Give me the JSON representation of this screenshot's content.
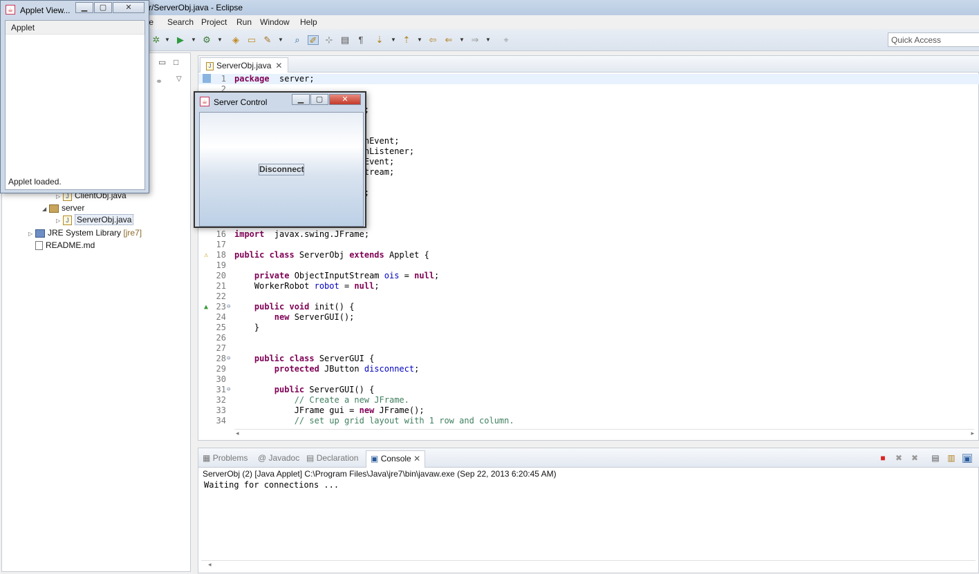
{
  "window": {
    "title": "r/ServerObj.java - Eclipse"
  },
  "menu": [
    "te",
    "Search",
    "Project",
    "Run",
    "Window",
    "Help"
  ],
  "quick_access": {
    "placeholder": "Quick Access"
  },
  "explorer": {
    "items": [
      {
        "label": "ClientObj.java"
      },
      {
        "label": "server"
      },
      {
        "label": "ServerObj.java"
      },
      {
        "label": "JRE System Library",
        "suffix": "[jre7]"
      },
      {
        "label": "README.md"
      }
    ]
  },
  "editor": {
    "tab_label": "ServerObj.java",
    "lines": [
      {
        "n": "1",
        "parts": [
          [
            "kw",
            "package"
          ],
          [
            "",
            "  server;"
          ]
        ]
      },
      {
        "n": "2",
        "parts": []
      },
      {
        "n": "",
        "parts": [
          [
            "",
            ";"
          ]
        ],
        "indent": "                          "
      },
      {
        "n": "",
        "parts": [
          [
            "",
            "nEvent;"
          ]
        ],
        "indent": "                          "
      },
      {
        "n": "",
        "parts": [
          [
            "",
            "nListener;"
          ]
        ],
        "indent": "                          "
      },
      {
        "n": "",
        "parts": [
          [
            "",
            "Event;"
          ]
        ],
        "indent": "                          "
      },
      {
        "n": "",
        "parts": [
          [
            "",
            "tream;"
          ]
        ],
        "indent": "                          "
      },
      {
        "n": "",
        "parts": [
          [
            "",
            ";"
          ]
        ],
        "indent": "                          "
      },
      {
        "n": "16",
        "parts": [
          [
            "kw",
            "import"
          ],
          [
            "",
            "  javax.swing.JFrame;"
          ]
        ]
      },
      {
        "n": "17",
        "parts": []
      },
      {
        "n": "18",
        "parts": [
          [
            "kw",
            "public class"
          ],
          [
            "",
            " ServerObj "
          ],
          [
            "kw",
            "extends"
          ],
          [
            "",
            " Applet {"
          ]
        ]
      },
      {
        "n": "19",
        "parts": []
      },
      {
        "n": "20",
        "parts": [
          [
            "",
            "    "
          ],
          [
            "kw",
            "private"
          ],
          [
            "",
            " ObjectInputStream "
          ],
          [
            "fld",
            "ois"
          ],
          [
            "",
            " = "
          ],
          [
            "kw",
            "null"
          ],
          [
            "",
            ";"
          ]
        ]
      },
      {
        "n": "21",
        "parts": [
          [
            "",
            "    WorkerRobot "
          ],
          [
            "fld",
            "robot"
          ],
          [
            "",
            " = "
          ],
          [
            "kw",
            "null"
          ],
          [
            "",
            ";"
          ]
        ]
      },
      {
        "n": "22",
        "parts": []
      },
      {
        "n": "23",
        "parts": [
          [
            "",
            "    "
          ],
          [
            "kw",
            "public void"
          ],
          [
            "",
            " init() {"
          ]
        ]
      },
      {
        "n": "24",
        "parts": [
          [
            "",
            "        "
          ],
          [
            "kw",
            "new"
          ],
          [
            "",
            " ServerGUI();"
          ]
        ]
      },
      {
        "n": "25",
        "parts": [
          [
            "",
            "    }"
          ]
        ]
      },
      {
        "n": "26",
        "parts": []
      },
      {
        "n": "27",
        "parts": []
      },
      {
        "n": "28",
        "parts": [
          [
            "",
            "    "
          ],
          [
            "kw",
            "public class"
          ],
          [
            "",
            " ServerGUI {"
          ]
        ]
      },
      {
        "n": "29",
        "parts": [
          [
            "",
            "        "
          ],
          [
            "kw",
            "protected"
          ],
          [
            "",
            " JButton "
          ],
          [
            "fld",
            "disconnect"
          ],
          [
            "",
            ";"
          ]
        ]
      },
      {
        "n": "30",
        "parts": []
      },
      {
        "n": "31",
        "parts": [
          [
            "",
            "        "
          ],
          [
            "kw",
            "public"
          ],
          [
            "",
            " ServerGUI() {"
          ]
        ]
      },
      {
        "n": "32",
        "parts": [
          [
            "",
            "            "
          ],
          [
            "cm",
            "// Create a new JFrame."
          ]
        ]
      },
      {
        "n": "33",
        "parts": [
          [
            "",
            "            JFrame gui = "
          ],
          [
            "kw",
            "new"
          ],
          [
            "",
            " JFrame();"
          ]
        ]
      },
      {
        "n": "34",
        "parts": [
          [
            "",
            "            "
          ],
          [
            "cm",
            "// set up grid layout with 1 row and column."
          ]
        ]
      }
    ]
  },
  "bottom": {
    "tabs": [
      "Problems",
      "@ Javadoc",
      "Declaration",
      "Console"
    ],
    "process": "ServerObj (2) [Java Applet] C:\\Program Files\\Java\\jre7\\bin\\javaw.exe (Sep 22, 2013 6:20:45 AM)",
    "output": "Waiting for connections ..."
  },
  "applet_viewer": {
    "title": "Applet View...",
    "menu": "Applet",
    "status": "Applet loaded."
  },
  "server_control": {
    "title": "Server Control",
    "button": "Disconnect"
  }
}
